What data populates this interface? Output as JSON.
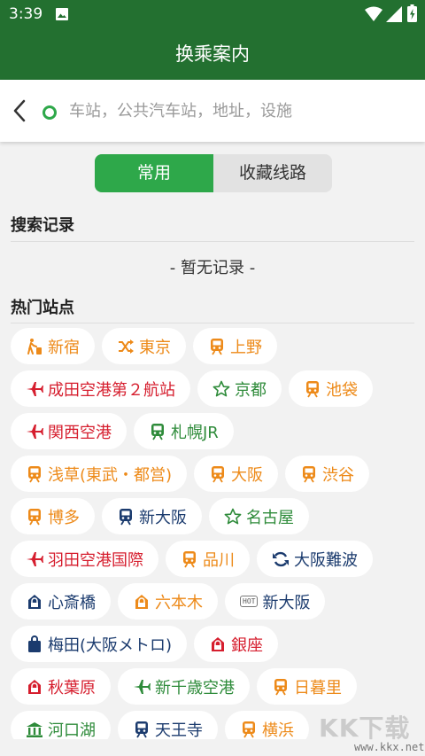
{
  "status_bar": {
    "time": "3:39"
  },
  "header": {
    "title": "换乘案内"
  },
  "search": {
    "placeholder": "车站，公共汽车站，地址，设施"
  },
  "segments": {
    "tab1": "常用",
    "tab2": "收藏线路"
  },
  "history": {
    "heading": "搜索记录",
    "empty_text": "- 暂无记录 -"
  },
  "popular": {
    "heading": "热门站点",
    "rows": [
      [
        {
          "label": "新宿",
          "icon": "walk-icon",
          "color": "o"
        },
        {
          "label": "東京",
          "icon": "shuffle-icon",
          "color": "o"
        },
        {
          "label": "上野",
          "icon": "train-icon",
          "color": "o"
        }
      ],
      [
        {
          "label": "成田空港第２航站",
          "icon": "airplane-icon",
          "color": "r"
        },
        {
          "label": "京都",
          "icon": "star-icon",
          "color": "g"
        },
        {
          "label": "池袋",
          "icon": "train-icon",
          "color": "o"
        }
      ],
      [
        {
          "label": "関西空港",
          "icon": "airplane-icon",
          "color": "r"
        },
        {
          "label": "札幌JR",
          "icon": "train-icon",
          "color": "g"
        }
      ],
      [
        {
          "label": "浅草(東武・都営)",
          "icon": "train-icon",
          "color": "o"
        },
        {
          "label": "大阪",
          "icon": "train-icon",
          "color": "o"
        },
        {
          "label": "渋谷",
          "icon": "train-icon",
          "color": "o"
        }
      ],
      [
        {
          "label": "博多",
          "icon": "train-icon",
          "color": "o"
        },
        {
          "label": "新大阪",
          "icon": "train-icon",
          "color": "b"
        },
        {
          "label": "名古屋",
          "icon": "star-icon",
          "color": "g"
        }
      ],
      [
        {
          "label": "羽田空港国際",
          "icon": "airplane-icon",
          "color": "r"
        },
        {
          "label": "品川",
          "icon": "train-icon",
          "color": "o"
        },
        {
          "label": "大阪難波",
          "icon": "refresh-icon",
          "color": "b"
        }
      ],
      [
        {
          "label": "心斎橋",
          "icon": "shopping-icon",
          "color": "b"
        },
        {
          "label": "六本木",
          "icon": "shopping-icon",
          "color": "o"
        },
        {
          "label": "新大阪",
          "icon": "hot-icon",
          "color": "b",
          "badge": "HOT"
        }
      ],
      [
        {
          "label": "梅田(大阪メトロ)",
          "icon": "bag-icon",
          "color": "b"
        },
        {
          "label": "銀座",
          "icon": "shopping-icon",
          "color": "r"
        }
      ],
      [
        {
          "label": "秋葉原",
          "icon": "shopping-icon",
          "color": "r"
        },
        {
          "label": "新千歳空港",
          "icon": "airplane-icon",
          "color": "g"
        },
        {
          "label": "日暮里",
          "icon": "train-icon",
          "color": "o"
        }
      ],
      [
        {
          "label": "河口湖",
          "icon": "temple-icon",
          "color": "g"
        },
        {
          "label": "天王寺",
          "icon": "train-icon",
          "color": "b"
        },
        {
          "label": "横浜",
          "icon": "train-icon",
          "color": "o"
        }
      ]
    ]
  },
  "watermark": {
    "text": "KK下载",
    "url": "www.kkx.net"
  },
  "colors": {
    "header_green": "#237030",
    "accent_green": "#2ea84a",
    "orange": "#ed8a19",
    "red": "#d61e2e",
    "green": "#2e8b3a",
    "navy": "#1b3b6e"
  }
}
